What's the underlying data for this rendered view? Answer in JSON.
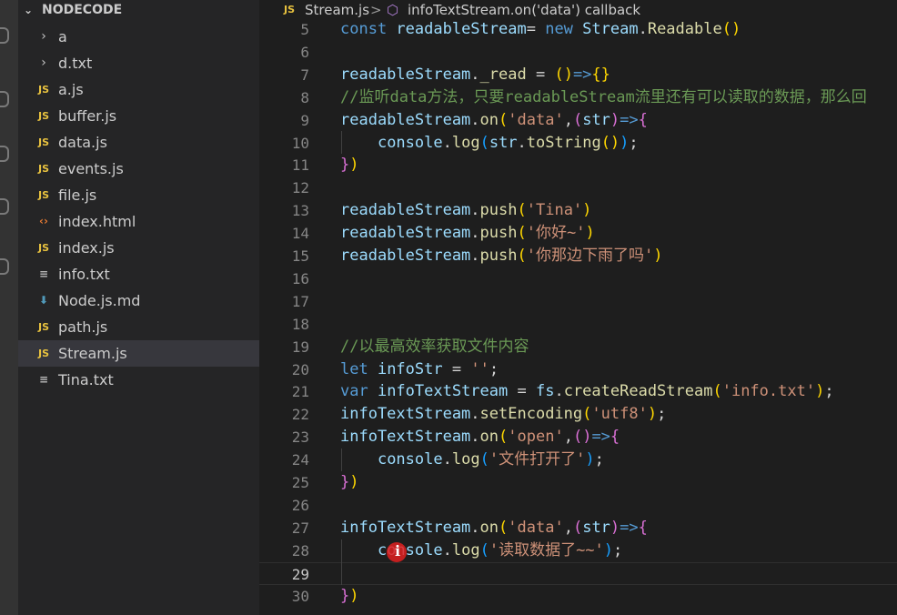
{
  "explorer": {
    "title": "NODECODE",
    "items": [
      {
        "label": "a",
        "icon": "chevron-right-icon",
        "kind": "folder"
      },
      {
        "label": "d.txt",
        "icon": "chevron-right-icon",
        "kind": "folder"
      },
      {
        "label": "a.js",
        "icon": "js-file-icon",
        "kind": "js"
      },
      {
        "label": "buffer.js",
        "icon": "js-file-icon",
        "kind": "js"
      },
      {
        "label": "data.js",
        "icon": "js-file-icon",
        "kind": "js"
      },
      {
        "label": "events.js",
        "icon": "js-file-icon",
        "kind": "js"
      },
      {
        "label": "file.js",
        "icon": "js-file-icon",
        "kind": "js"
      },
      {
        "label": "index.html",
        "icon": "html-file-icon",
        "kind": "html"
      },
      {
        "label": "index.js",
        "icon": "js-file-icon",
        "kind": "js"
      },
      {
        "label": "info.txt",
        "icon": "text-file-icon",
        "kind": "txt"
      },
      {
        "label": "Node.js.md",
        "icon": "markdown-file-icon",
        "kind": "md"
      },
      {
        "label": "path.js",
        "icon": "js-file-icon",
        "kind": "js"
      },
      {
        "label": "Stream.js",
        "icon": "js-file-icon",
        "kind": "js",
        "active": true
      },
      {
        "label": "Tina.txt",
        "icon": "text-file-icon",
        "kind": "txt"
      }
    ]
  },
  "breadcrumb": {
    "lang_badge": "JS",
    "file": "Stream.js",
    "separator": ">",
    "symbol": "infoTextStream.on('data') callback"
  },
  "colors": {
    "keyword": "#569cd6",
    "variable": "#9cdcfe",
    "function": "#dcdcaa",
    "string": "#ce9178",
    "comment": "#6a9955",
    "plain": "#d4d4d4",
    "bracket_gold": "#ffd700",
    "bracket_purple": "#da70d6",
    "bracket_blue": "#179fff"
  },
  "editor": {
    "current_line": 29,
    "lines": [
      {
        "n": "5",
        "tokens": [
          {
            "t": "const ",
            "c": "keyword"
          },
          {
            "t": "readableStream",
            "c": "variable"
          },
          {
            "t": "= ",
            "c": "plain"
          },
          {
            "t": "new ",
            "c": "keyword"
          },
          {
            "t": "Stream",
            "c": "variable"
          },
          {
            "t": ".",
            "c": "plain"
          },
          {
            "t": "Readable",
            "c": "function"
          },
          {
            "t": "()",
            "c": "bracket_gold"
          }
        ]
      },
      {
        "n": "6",
        "tokens": []
      },
      {
        "n": "7",
        "tokens": [
          {
            "t": "readableStream",
            "c": "variable"
          },
          {
            "t": ".",
            "c": "plain"
          },
          {
            "t": "_read",
            "c": "function"
          },
          {
            "t": " = ",
            "c": "plain"
          },
          {
            "t": "()",
            "c": "bracket_gold"
          },
          {
            "t": "=>",
            "c": "keyword"
          },
          {
            "t": "{}",
            "c": "bracket_gold"
          }
        ]
      },
      {
        "n": "8",
        "tokens": [
          {
            "t": "//监听data方法，只要readableStream流里还有可以读取的数据，那么回",
            "c": "comment"
          }
        ]
      },
      {
        "n": "9",
        "tokens": [
          {
            "t": "readableStream",
            "c": "variable"
          },
          {
            "t": ".",
            "c": "plain"
          },
          {
            "t": "on",
            "c": "function"
          },
          {
            "t": "(",
            "c": "bracket_gold"
          },
          {
            "t": "'data'",
            "c": "string"
          },
          {
            "t": ",",
            "c": "plain"
          },
          {
            "t": "(",
            "c": "bracket_purple"
          },
          {
            "t": "str",
            "c": "variable"
          },
          {
            "t": ")",
            "c": "bracket_purple"
          },
          {
            "t": "=>",
            "c": "keyword"
          },
          {
            "t": "{",
            "c": "bracket_purple"
          }
        ]
      },
      {
        "n": "10",
        "tokens": [
          {
            "t": "    ",
            "c": "plain"
          },
          {
            "t": "console",
            "c": "variable"
          },
          {
            "t": ".",
            "c": "plain"
          },
          {
            "t": "log",
            "c": "function"
          },
          {
            "t": "(",
            "c": "bracket_blue"
          },
          {
            "t": "str",
            "c": "variable"
          },
          {
            "t": ".",
            "c": "plain"
          },
          {
            "t": "toString",
            "c": "function"
          },
          {
            "t": "()",
            "c": "bracket_gold"
          },
          {
            "t": ")",
            "c": "bracket_blue"
          },
          {
            "t": ";",
            "c": "plain"
          }
        ]
      },
      {
        "n": "11",
        "tokens": [
          {
            "t": "}",
            "c": "bracket_purple"
          },
          {
            "t": ")",
            "c": "bracket_gold"
          }
        ]
      },
      {
        "n": "12",
        "tokens": []
      },
      {
        "n": "13",
        "tokens": [
          {
            "t": "readableStream",
            "c": "variable"
          },
          {
            "t": ".",
            "c": "plain"
          },
          {
            "t": "push",
            "c": "function"
          },
          {
            "t": "(",
            "c": "bracket_gold"
          },
          {
            "t": "'Tina'",
            "c": "string"
          },
          {
            "t": ")",
            "c": "bracket_gold"
          }
        ]
      },
      {
        "n": "14",
        "tokens": [
          {
            "t": "readableStream",
            "c": "variable"
          },
          {
            "t": ".",
            "c": "plain"
          },
          {
            "t": "push",
            "c": "function"
          },
          {
            "t": "(",
            "c": "bracket_gold"
          },
          {
            "t": "'你好~'",
            "c": "string"
          },
          {
            "t": ")",
            "c": "bracket_gold"
          }
        ]
      },
      {
        "n": "15",
        "tokens": [
          {
            "t": "readableStream",
            "c": "variable"
          },
          {
            "t": ".",
            "c": "plain"
          },
          {
            "t": "push",
            "c": "function"
          },
          {
            "t": "(",
            "c": "bracket_gold"
          },
          {
            "t": "'你那边下雨了吗'",
            "c": "string"
          },
          {
            "t": ")",
            "c": "bracket_gold"
          }
        ]
      },
      {
        "n": "16",
        "tokens": []
      },
      {
        "n": "17",
        "tokens": []
      },
      {
        "n": "18",
        "tokens": []
      },
      {
        "n": "19",
        "tokens": [
          {
            "t": "//以最高效率获取文件内容",
            "c": "comment"
          }
        ]
      },
      {
        "n": "20",
        "tokens": [
          {
            "t": "let ",
            "c": "keyword"
          },
          {
            "t": "infoStr",
            "c": "variable"
          },
          {
            "t": " = ",
            "c": "plain"
          },
          {
            "t": "''",
            "c": "string"
          },
          {
            "t": ";",
            "c": "plain"
          }
        ]
      },
      {
        "n": "21",
        "tokens": [
          {
            "t": "var ",
            "c": "keyword"
          },
          {
            "t": "infoTextStream",
            "c": "variable"
          },
          {
            "t": " = ",
            "c": "plain"
          },
          {
            "t": "fs",
            "c": "variable"
          },
          {
            "t": ".",
            "c": "plain"
          },
          {
            "t": "createReadStream",
            "c": "function"
          },
          {
            "t": "(",
            "c": "bracket_gold"
          },
          {
            "t": "'info.txt'",
            "c": "string"
          },
          {
            "t": ")",
            "c": "bracket_gold"
          },
          {
            "t": ";",
            "c": "plain"
          }
        ]
      },
      {
        "n": "22",
        "tokens": [
          {
            "t": "infoTextStream",
            "c": "variable"
          },
          {
            "t": ".",
            "c": "plain"
          },
          {
            "t": "setEncoding",
            "c": "function"
          },
          {
            "t": "(",
            "c": "bracket_gold"
          },
          {
            "t": "'utf8'",
            "c": "string"
          },
          {
            "t": ")",
            "c": "bracket_gold"
          },
          {
            "t": ";",
            "c": "plain"
          }
        ]
      },
      {
        "n": "23",
        "tokens": [
          {
            "t": "infoTextStream",
            "c": "variable"
          },
          {
            "t": ".",
            "c": "plain"
          },
          {
            "t": "on",
            "c": "function"
          },
          {
            "t": "(",
            "c": "bracket_gold"
          },
          {
            "t": "'open'",
            "c": "string"
          },
          {
            "t": ",",
            "c": "plain"
          },
          {
            "t": "()",
            "c": "bracket_purple"
          },
          {
            "t": "=>",
            "c": "keyword"
          },
          {
            "t": "{",
            "c": "bracket_purple"
          }
        ]
      },
      {
        "n": "24",
        "tokens": [
          {
            "t": "    ",
            "c": "plain"
          },
          {
            "t": "console",
            "c": "variable"
          },
          {
            "t": ".",
            "c": "plain"
          },
          {
            "t": "log",
            "c": "function"
          },
          {
            "t": "(",
            "c": "bracket_blue"
          },
          {
            "t": "'文件打开了'",
            "c": "string"
          },
          {
            "t": ")",
            "c": "bracket_blue"
          },
          {
            "t": ";",
            "c": "plain"
          }
        ]
      },
      {
        "n": "25",
        "tokens": [
          {
            "t": "}",
            "c": "bracket_purple"
          },
          {
            "t": ")",
            "c": "bracket_gold"
          }
        ]
      },
      {
        "n": "26",
        "tokens": []
      },
      {
        "n": "27",
        "tokens": [
          {
            "t": "infoTextStream",
            "c": "variable"
          },
          {
            "t": ".",
            "c": "plain"
          },
          {
            "t": "on",
            "c": "function"
          },
          {
            "t": "(",
            "c": "bracket_gold"
          },
          {
            "t": "'data'",
            "c": "string"
          },
          {
            "t": ",",
            "c": "plain"
          },
          {
            "t": "(",
            "c": "bracket_purple"
          },
          {
            "t": "str",
            "c": "variable"
          },
          {
            "t": ")",
            "c": "bracket_purple"
          },
          {
            "t": "=>",
            "c": "keyword"
          },
          {
            "t": "{",
            "c": "bracket_purple"
          }
        ]
      },
      {
        "n": "28",
        "tokens": [
          {
            "t": "    ",
            "c": "plain"
          },
          {
            "t": "console",
            "c": "variable"
          },
          {
            "t": ".",
            "c": "plain"
          },
          {
            "t": "log",
            "c": "function"
          },
          {
            "t": "(",
            "c": "bracket_blue"
          },
          {
            "t": "'读取数据了~~'",
            "c": "string"
          },
          {
            "t": ")",
            "c": "bracket_blue"
          },
          {
            "t": ";",
            "c": "plain"
          }
        ]
      },
      {
        "n": "29",
        "tokens": []
      },
      {
        "n": "30",
        "tokens": [
          {
            "t": "}",
            "c": "bracket_purple"
          },
          {
            "t": ")",
            "c": "bracket_gold"
          }
        ]
      }
    ]
  }
}
